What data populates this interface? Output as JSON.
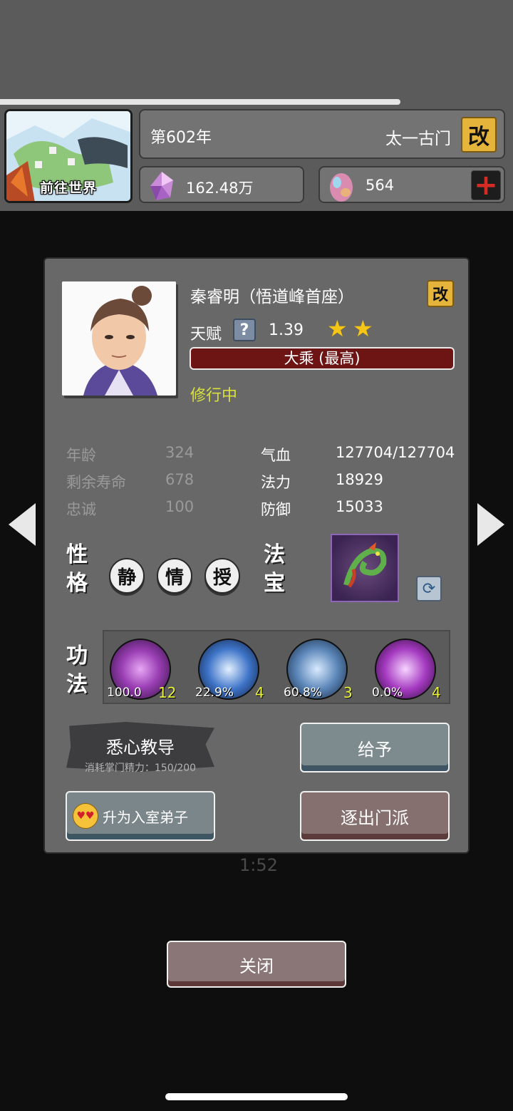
{
  "header": {
    "progress": 0.78,
    "world_button_label": "前往世界",
    "year": "第602年",
    "sect_name": "太一古门",
    "edit_glyph": "改",
    "spirit_stones": "162.48万",
    "eggs": "564",
    "add_glyph": "+"
  },
  "background": {
    "timer": "1:52"
  },
  "disciple": {
    "name": "秦睿明（悟道峰首座）",
    "edit_glyph": "改",
    "talent_label": "天赋",
    "talent_help_glyph": "?",
    "talent_value": "1.39",
    "stars": 2,
    "realm": "大乘 (最高)",
    "status": "修行中",
    "stats_left": [
      {
        "label": "年龄",
        "value": "324"
      },
      {
        "label": "剩余寿命",
        "value": "678"
      },
      {
        "label": "忠诚",
        "value": "100"
      }
    ],
    "stats_right": [
      {
        "label": "气血",
        "value": "127704/127704"
      },
      {
        "label": "法力",
        "value": "18929"
      },
      {
        "label": "防御",
        "value": "15033"
      }
    ],
    "personality_label": [
      "性",
      "格"
    ],
    "traits": [
      "静",
      "情",
      "授"
    ],
    "treasure_label": [
      "法",
      "宝"
    ],
    "skills_label": [
      "功",
      "法"
    ],
    "skills": [
      {
        "progress": "100.0",
        "level": "12",
        "color": "#9b3fb5"
      },
      {
        "progress": "22.9%",
        "level": "4",
        "color": "#3e74c8"
      },
      {
        "progress": "60.8%",
        "level": "3",
        "color": "#5b86b8"
      },
      {
        "progress": "0.0%",
        "level": "4",
        "color": "#a43ac0"
      }
    ]
  },
  "actions": {
    "teach_label": "悉心教导",
    "teach_cost": "消耗掌门精力：150/200",
    "give_label": "给予",
    "promote_label": "升为入室弟子",
    "expel_label": "逐出门派",
    "close_label": "关闭"
  },
  "colors": {
    "realm_bar": "#6d1515",
    "status": "#d8e03c",
    "skill_level": "#e9f23a",
    "star": "#f5c518"
  }
}
